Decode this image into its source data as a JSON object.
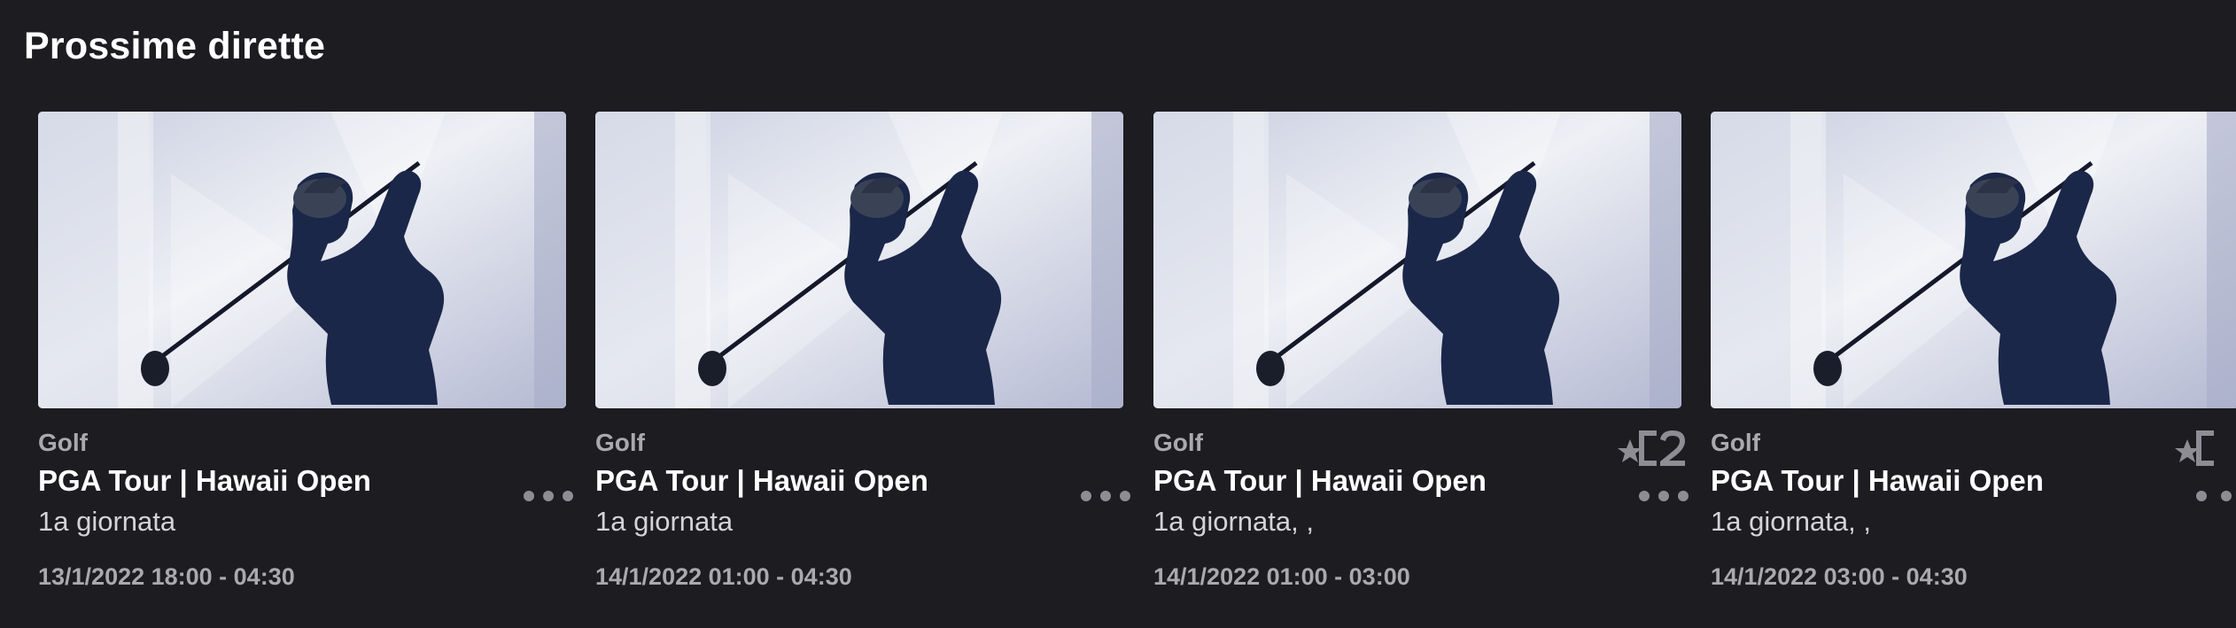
{
  "section": {
    "title": "Prossime dirette"
  },
  "cards": [
    {
      "sport": "Golf",
      "title": "PGA Tour | Hawaii Open",
      "subtitle": "1a giornata",
      "datetime": "13/1/2022 18:00 - 04:30",
      "channel_logo": null
    },
    {
      "sport": "Golf",
      "title": "PGA Tour | Hawaii Open",
      "subtitle": "1a giornata",
      "datetime": "14/1/2022 01:00 - 04:30",
      "channel_logo": null
    },
    {
      "sport": "Golf",
      "title": "PGA Tour | Hawaii Open",
      "subtitle": "1a giornata, ,",
      "datetime": "14/1/2022 01:00 - 03:00",
      "channel_logo": "eurosport-2-icon"
    },
    {
      "sport": "Golf",
      "title": "PGA Tour | Hawaii Open",
      "subtitle": "1a giornata, ,",
      "datetime": "14/1/2022 03:00 - 04:30",
      "channel_logo": "eurosport-2-icon"
    }
  ],
  "colors": {
    "background": "#1c1c21",
    "muted_text": "#a9a9ae",
    "dots": "#8d8d93"
  },
  "icons": {
    "more": "more-options-icon",
    "thumbnail": "golfer-swing-thumbnail"
  }
}
